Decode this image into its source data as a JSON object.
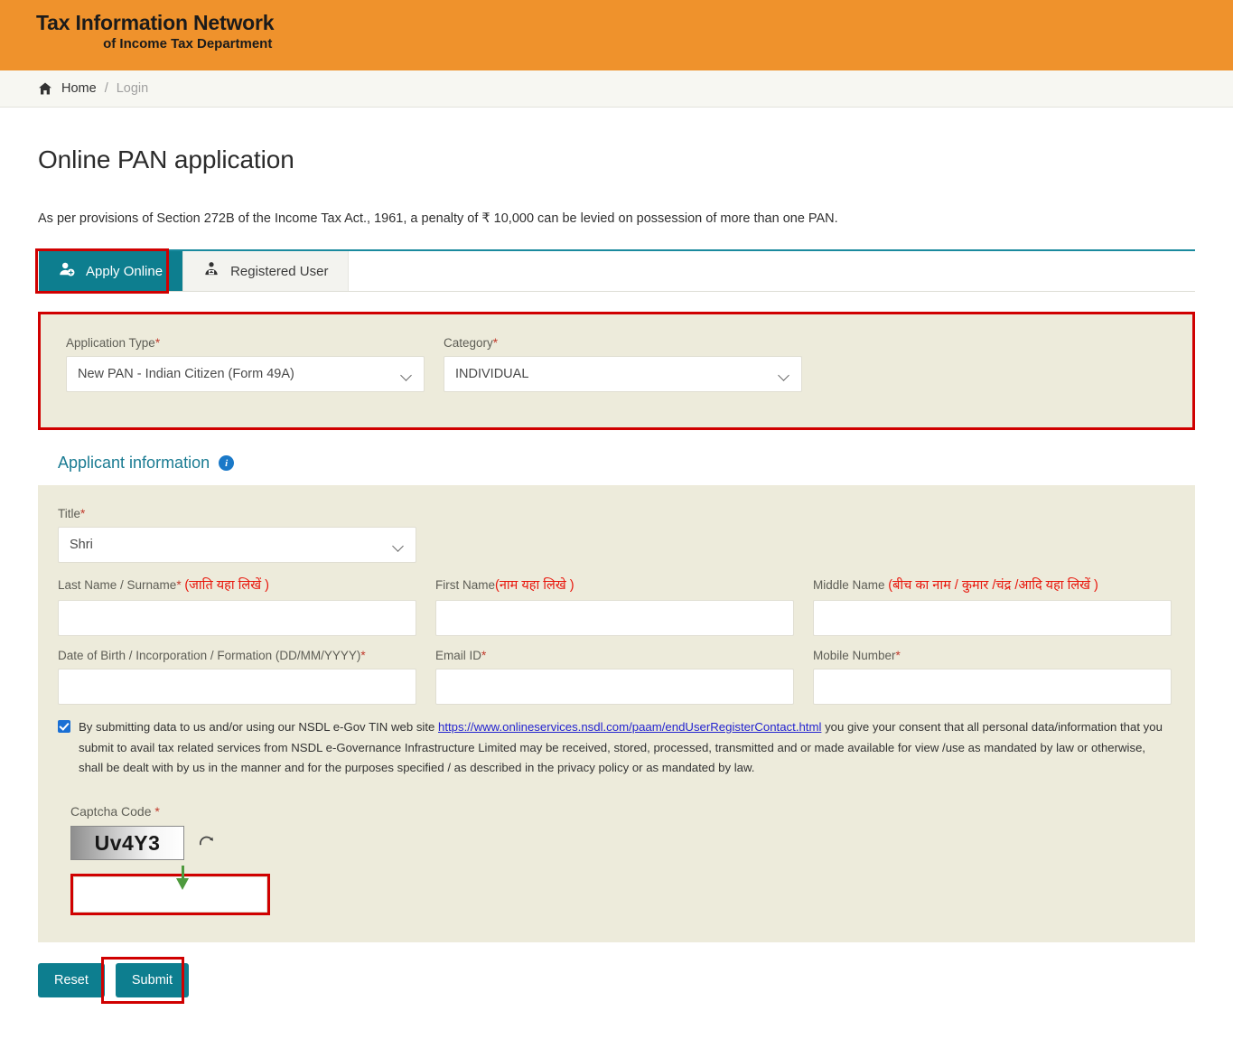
{
  "header": {
    "logo_line1": "Tax Information Network",
    "logo_line2": "of Income Tax Department",
    "bg_color": "#ef922c"
  },
  "breadcrumb": {
    "home_icon": "home-icon",
    "home_label": "Home",
    "separator": "/",
    "current_label": "Login"
  },
  "main": {
    "page_title": "Online PAN application",
    "intro_text": "As per provisions of Section 272B of the Income Tax Act., 1961, a penalty of ₹ 10,000 can be levied on possession of more than one PAN."
  },
  "tabs": [
    {
      "label": "Apply Online",
      "icon": "user-add-icon",
      "active": true
    },
    {
      "label": "Registered User",
      "icon": "user-check-icon",
      "active": false
    }
  ],
  "application_type_panel": {
    "application_type": {
      "label": "Application Type",
      "required_mark": "*",
      "value": "New PAN - Indian Citizen (Form 49A)"
    },
    "category": {
      "label": "Category",
      "required_mark": "*",
      "value": "INDIVIDUAL"
    }
  },
  "applicant_section": {
    "heading": "Applicant information",
    "info_icon_glyph": "i",
    "title_field": {
      "label": "Title",
      "required_mark": "*",
      "value": "Shri"
    },
    "last_name": {
      "label": "Last Name / Surname",
      "required_mark": "*",
      "hindi_note": "(जाति यहा लिखें )",
      "value": ""
    },
    "first_name": {
      "label": "First Name",
      "required_mark": "",
      "hindi_note": "(नाम यहा लिखे )",
      "value": ""
    },
    "middle_name": {
      "label": "Middle Name ",
      "required_mark": "",
      "hindi_note": "(बीच का नाम / कुमार /चंद्र /आदि यहा लिखें )",
      "value": ""
    },
    "dob": {
      "label": "Date of Birth / Incorporation / Formation (DD/MM/YYYY)",
      "required_mark": "*",
      "value": ""
    },
    "email": {
      "label": "Email ID",
      "required_mark": "*",
      "value": ""
    },
    "mobile": {
      "label": "Mobile Number",
      "required_mark": "*",
      "value": ""
    }
  },
  "consent": {
    "checked": true,
    "text_before": "By submitting data to us and/or using our NSDL e-Gov TIN web site ",
    "link_text": "https://www.onlineservices.nsdl.com/paam/endUserRegisterContact.html",
    "text_after": " you give your consent that all personal data/information that you submit to avail tax related services from NSDL e-Governance Infrastructure Limited may be received, stored, processed, transmitted and or made available for view /use as mandated by law or otherwise, shall be dealt with by us in the manner and for the purposes specified / as described in the privacy policy or as mandated by law."
  },
  "captcha": {
    "label": "Captcha Code ",
    "required_mark": "*",
    "code_text": "Uv4Y3",
    "refresh_icon": "refresh-icon",
    "input_value": ""
  },
  "buttons": {
    "reset_label": "Reset",
    "submit_label": "Submit"
  },
  "colors": {
    "header_orange": "#ef922c",
    "teal_accent": "#0d7e8f",
    "panel_beige": "#edebdb",
    "highlight_red": "#d00000",
    "link_blue": "#2424cf",
    "hindi_red": "#e8160c"
  }
}
